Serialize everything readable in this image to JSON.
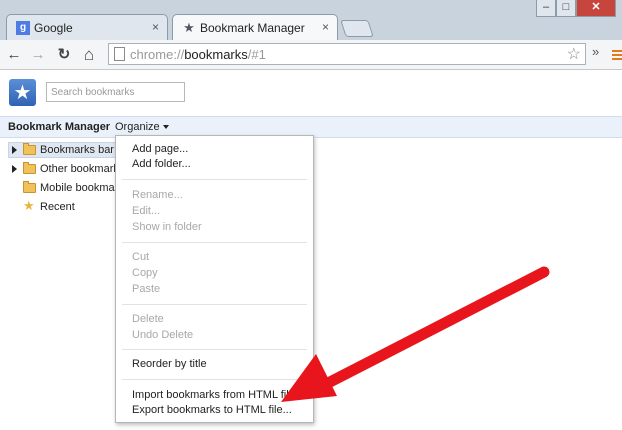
{
  "tabs": [
    {
      "title": "Google",
      "icon": "google-favicon-icon",
      "close": "×"
    },
    {
      "title": "Bookmark Manager",
      "icon": "star-favicon-icon",
      "close": "×"
    }
  ],
  "window_controls": {
    "minimize": "–",
    "maximize": "□",
    "close": "✕"
  },
  "toolbar": {
    "back": "←",
    "forward": "→",
    "reload": "↻",
    "home": "⌂",
    "url_scheme": "chrome://",
    "url_host": "bookmarks",
    "url_path": "/#1",
    "star": "☆",
    "overflow": "»"
  },
  "bookmarks": {
    "logo": "★",
    "search_placeholder": "Search bookmarks",
    "title": "Bookmark Manager",
    "organize": "Organize"
  },
  "tree": [
    {
      "label": "Bookmarks bar",
      "icon": "folder-icon",
      "expandable": true,
      "selected": true
    },
    {
      "label": "Other bookmarks",
      "icon": "folder-icon",
      "expandable": true,
      "selected": false
    },
    {
      "label": "Mobile bookmarks",
      "icon": "folder-icon",
      "expandable": false,
      "selected": false
    },
    {
      "label": "Recent",
      "icon": "star-icon",
      "expandable": false,
      "selected": false
    }
  ],
  "organize_menu": {
    "add_page": "Add page...",
    "add_folder": "Add folder...",
    "rename": "Rename...",
    "edit": "Edit...",
    "show_in_folder": "Show in folder",
    "cut": "Cut",
    "copy": "Copy",
    "paste": "Paste",
    "delete": "Delete",
    "undo_delete": "Undo Delete",
    "reorder": "Reorder by title",
    "import": "Import bookmarks from HTML file...",
    "export": "Export bookmarks to HTML file..."
  },
  "colors": {
    "accent_blue": "#2f62b4",
    "annotation_red": "#e8161c",
    "folder": "#f2c25a",
    "menu_disabled": "#a8a8a8"
  }
}
